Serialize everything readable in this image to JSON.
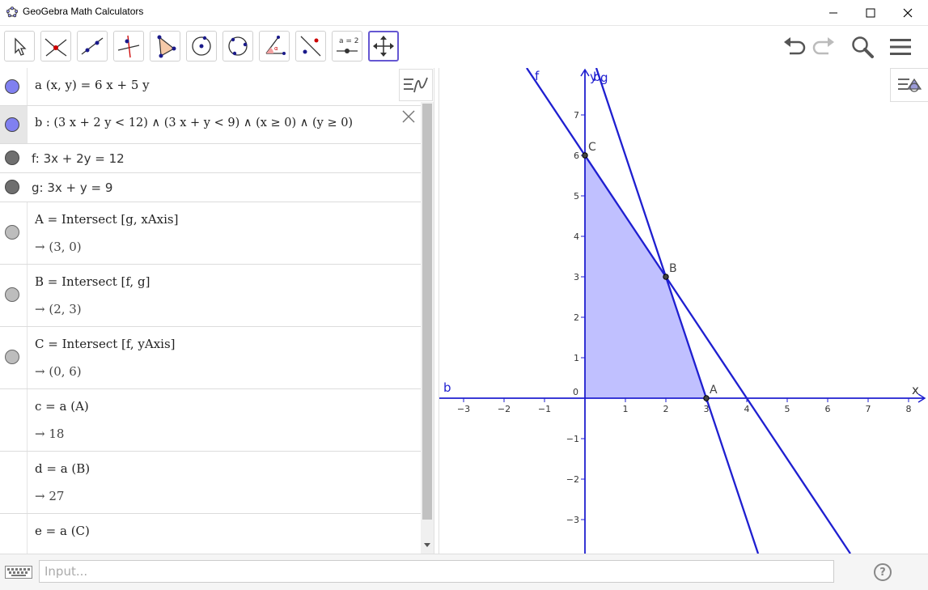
{
  "window": {
    "title": "GeoGebra Math Calculators",
    "controls": [
      "minimize-icon",
      "maximize-icon",
      "close-icon"
    ]
  },
  "toolbar": {
    "tools": [
      {
        "name": "move-tool-icon"
      },
      {
        "name": "point-on-object-icon"
      },
      {
        "name": "line-through-two-points-icon"
      },
      {
        "name": "perpendicular-line-icon"
      },
      {
        "name": "polygon-icon"
      },
      {
        "name": "circle-center-point-icon"
      },
      {
        "name": "circle-three-points-icon"
      },
      {
        "name": "angle-icon"
      },
      {
        "name": "reflect-about-line-icon"
      },
      {
        "name": "slider-icon",
        "label": "a = 2"
      },
      {
        "name": "move-graphics-view-icon",
        "active": true
      }
    ],
    "right": [
      "undo-icon",
      "redo-icon",
      "search-icon",
      "menu-icon"
    ]
  },
  "algebra": {
    "rows": [
      {
        "label": "a (x, y)  =  6 x + 5 y",
        "color": "#8080f0"
      },
      {
        "label": "b :  (3 x + 2 y < 12) ∧ (3 x + y < 9) ∧ (x ≥ 0) ∧ (y ≥ 0)",
        "color": "#8080f0"
      },
      {
        "label": "f: 3x + 2y = 12",
        "color": "#6f6f6f"
      },
      {
        "label": "g: 3x + y = 9",
        "color": "#6f6f6f"
      },
      {
        "label": "A = Intersect [g, xAxis]",
        "value": "→  (3, 0)",
        "color": "#bdbdbd"
      },
      {
        "label": "B = Intersect [f, g]",
        "value": "→  (2, 3)",
        "color": "#bdbdbd"
      },
      {
        "label": "C = Intersect [f, yAxis]",
        "value": "→  (0, 6)",
        "color": "#bdbdbd"
      },
      {
        "label": "c = a (A)",
        "value": "→  18"
      },
      {
        "label": "d = a (B)",
        "value": "→  27"
      },
      {
        "label": "e = a (C)"
      }
    ]
  },
  "graphics": {
    "axis_labels": {
      "x": "x",
      "y": "y"
    },
    "x_ticks": [
      -3,
      -2,
      -1,
      0,
      1,
      2,
      3,
      4,
      5,
      6,
      7,
      8
    ],
    "y_ticks": [
      -3,
      -2,
      -1,
      1,
      2,
      3,
      4,
      5,
      6,
      7
    ],
    "origin_label": "0",
    "point_labels": {
      "A": "A",
      "B": "B",
      "C": "C"
    },
    "line_labels": {
      "f": "f",
      "g": "g",
      "b_left": "b",
      "b_top": "b"
    },
    "points": {
      "A": [
        3,
        0
      ],
      "B": [
        2,
        3
      ],
      "C": [
        0,
        6
      ]
    },
    "region_color": "#c0c0ff",
    "line_color": "#1f1fd0",
    "axis_color": "#1f1fd0"
  },
  "input": {
    "placeholder": "Input..."
  }
}
